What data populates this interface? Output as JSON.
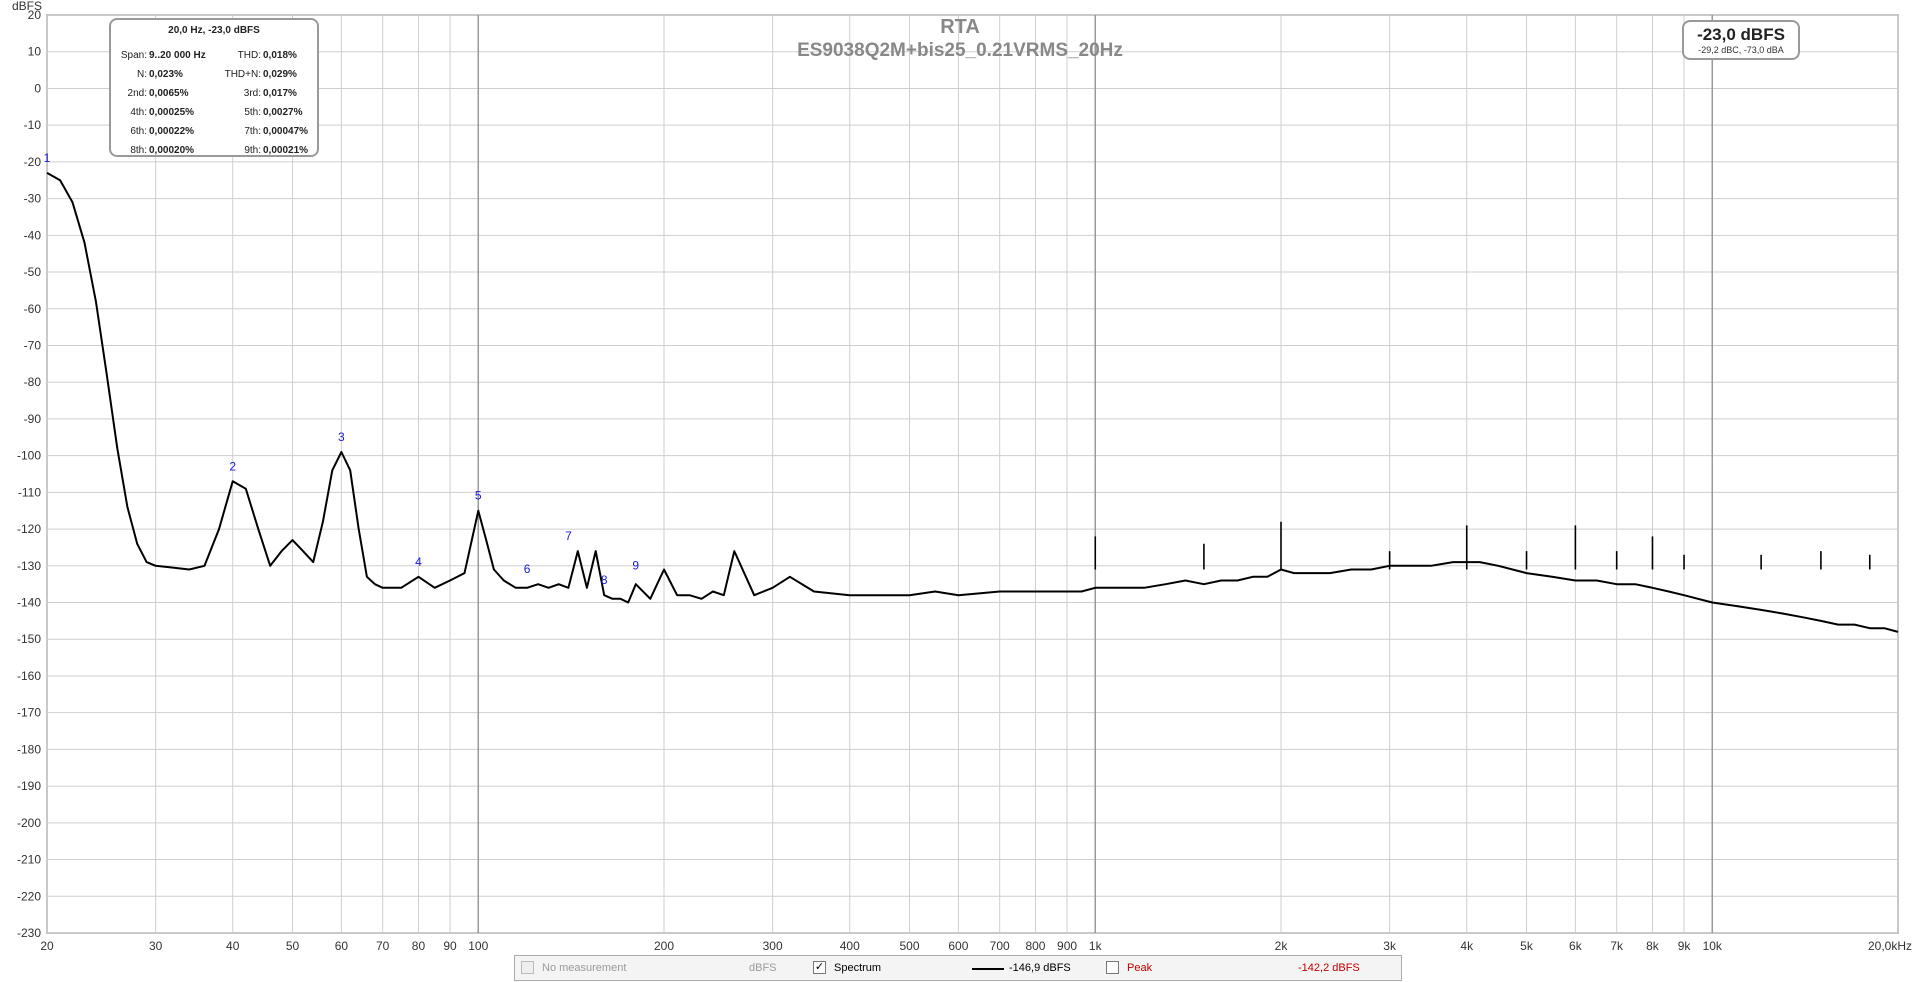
{
  "chart_data": {
    "type": "line",
    "title": "RTA",
    "subtitle": "ES9038Q2M+bis25_0.21VRMS_20Hz",
    "ylabel": "dBFS",
    "xscale": "log",
    "xlim": [
      20,
      20000
    ],
    "ylim": [
      -230,
      20
    ],
    "grid": true,
    "yticks": [
      20,
      10,
      0,
      -10,
      -20,
      -30,
      -40,
      -50,
      -60,
      -70,
      -80,
      -90,
      -100,
      -110,
      -120,
      -130,
      -140,
      -150,
      -160,
      -170,
      -180,
      -190,
      -200,
      -210,
      -220,
      -230
    ],
    "xticks": [
      {
        "f": 20,
        "label": "20"
      },
      {
        "f": 30,
        "label": "30"
      },
      {
        "f": 40,
        "label": "40"
      },
      {
        "f": 50,
        "label": "50"
      },
      {
        "f": 60,
        "label": "60"
      },
      {
        "f": 70,
        "label": "70"
      },
      {
        "f": 80,
        "label": "80"
      },
      {
        "f": 90,
        "label": "90"
      },
      {
        "f": 100,
        "label": "100"
      },
      {
        "f": 200,
        "label": "200"
      },
      {
        "f": 300,
        "label": "300"
      },
      {
        "f": 400,
        "label": "400"
      },
      {
        "f": 500,
        "label": "500"
      },
      {
        "f": 600,
        "label": "600"
      },
      {
        "f": 700,
        "label": "700"
      },
      {
        "f": 800,
        "label": "800"
      },
      {
        "f": 900,
        "label": "900"
      },
      {
        "f": 1000,
        "label": "1k"
      },
      {
        "f": 2000,
        "label": "2k"
      },
      {
        "f": 3000,
        "label": "3k"
      },
      {
        "f": 4000,
        "label": "4k"
      },
      {
        "f": 5000,
        "label": "5k"
      },
      {
        "f": 6000,
        "label": "6k"
      },
      {
        "f": 7000,
        "label": "7k"
      },
      {
        "f": 8000,
        "label": "8k"
      },
      {
        "f": 9000,
        "label": "9k"
      },
      {
        "f": 10000,
        "label": "10k"
      },
      {
        "f": 20000,
        "label": "20,0kHz"
      }
    ],
    "series": [
      {
        "name": "Spectrum",
        "x": [
          20,
          21,
          22,
          23,
          24,
          25,
          26,
          27,
          28,
          29,
          30,
          32,
          34,
          36,
          38,
          40,
          42,
          44,
          46,
          48,
          50,
          52,
          54,
          56,
          58,
          60,
          62,
          64,
          66,
          68,
          70,
          75,
          80,
          85,
          90,
          95,
          100,
          103,
          106,
          110,
          115,
          120,
          125,
          130,
          135,
          140,
          145,
          150,
          155,
          160,
          165,
          170,
          175,
          180,
          190,
          200,
          210,
          220,
          230,
          240,
          250,
          260,
          280,
          300,
          320,
          350,
          400,
          450,
          500,
          550,
          600,
          700,
          800,
          900,
          950,
          1000,
          1100,
          1200,
          1300,
          1400,
          1500,
          1600,
          1700,
          1800,
          1900,
          2000,
          2100,
          2200,
          2400,
          2600,
          2800,
          3000,
          3200,
          3500,
          3800,
          4000,
          4200,
          4500,
          5000,
          5500,
          6000,
          6500,
          7000,
          7500,
          8000,
          8500,
          9000,
          10000,
          11000,
          12000,
          13000,
          14000,
          15000,
          16000,
          17000,
          18000,
          19000,
          20000
        ],
        "y": [
          -23,
          -25,
          -31,
          -42,
          -58,
          -78,
          -98,
          -114,
          -124,
          -129,
          -130,
          -130.5,
          -131,
          -130,
          -120,
          -107,
          -109,
          -120,
          -130,
          -126,
          -123,
          -126,
          -129,
          -118,
          -104,
          -99,
          -104,
          -120,
          -133,
          -135,
          -136,
          -136,
          -133,
          -136,
          -134,
          -132,
          -115,
          -123,
          -131,
          -134,
          -136,
          -136,
          -135,
          -136,
          -135,
          -136,
          -126,
          -136,
          -126,
          -138,
          -139,
          -139,
          -140,
          -135,
          -139,
          -131,
          -138,
          -138,
          -139,
          -137,
          -138,
          -126,
          -138,
          -136,
          -133,
          -137,
          -138,
          -138,
          -138,
          -137,
          -138,
          -137,
          -137,
          -137,
          -137,
          -136,
          -136,
          -136,
          -135,
          -134,
          -135,
          -134,
          -134,
          -133,
          -133,
          -131,
          -132,
          -132,
          -132,
          -131,
          -131,
          -130,
          -130,
          -130,
          -129,
          -129,
          -129,
          -130,
          -132,
          -133,
          -134,
          -134,
          -135,
          -135,
          -136,
          -137,
          -138,
          -140,
          -141,
          -142,
          -143,
          -144,
          -145,
          -146,
          -146,
          -147,
          -147,
          -148
        ]
      }
    ],
    "peaks": [
      {
        "f": 2000,
        "y": -118
      },
      {
        "f": 3000,
        "y": -126
      },
      {
        "f": 4000,
        "y": -119
      },
      {
        "f": 6000,
        "y": -119
      },
      {
        "f": 8000,
        "y": -122
      },
      {
        "f": 1000,
        "y": -122
      },
      {
        "f": 1500,
        "y": -124
      },
      {
        "f": 5000,
        "y": -126
      },
      {
        "f": 7000,
        "y": -126
      },
      {
        "f": 9000,
        "y": -127
      },
      {
        "f": 12000,
        "y": -127
      },
      {
        "f": 15000,
        "y": -126
      },
      {
        "f": 18000,
        "y": -127
      }
    ],
    "markers": [
      {
        "label": "1",
        "f": 20,
        "y": -20
      },
      {
        "label": "2",
        "f": 40,
        "y": -104
      },
      {
        "label": "3",
        "f": 60,
        "y": -96
      },
      {
        "label": "4",
        "f": 80,
        "y": -130
      },
      {
        "label": "5",
        "f": 100,
        "y": -112
      },
      {
        "label": "6",
        "f": 120,
        "y": -132
      },
      {
        "label": "7",
        "f": 140,
        "y": -123
      },
      {
        "label": "8",
        "f": 160,
        "y": -135
      },
      {
        "label": "9",
        "f": 180,
        "y": -131
      }
    ]
  },
  "info_box": {
    "header": "20,0 Hz, -23,0 dBFS",
    "rows": [
      {
        "lk": "Span:",
        "lv": "9..20 000 Hz",
        "rk": "THD:",
        "rv": "0,018%"
      },
      {
        "lk": "N:",
        "lv": "0,023%",
        "rk": "THD+N:",
        "rv": "0,029%"
      },
      {
        "lk": "2nd:",
        "lv": "0,0065%",
        "rk": "3rd:",
        "rv": "0,017%"
      },
      {
        "lk": "4th:",
        "lv": "0,00025%",
        "rk": "5th:",
        "rv": "0,0027%"
      },
      {
        "lk": "6th:",
        "lv": "0,00022%",
        "rk": "7th:",
        "rv": "0,00047%"
      },
      {
        "lk": "8th:",
        "lv": "0,00020%",
        "rk": "9th:",
        "rv": "0,00021%"
      }
    ]
  },
  "level_box": {
    "main": "-23,0 dBFS",
    "sub": "-29,2 dBC, -73,0 dBA"
  },
  "legend": {
    "no_measurement": "No measurement",
    "no_measurement_value": "dBFS",
    "spectrum_label": "Spectrum",
    "spectrum_value": "-146,9 dBFS",
    "peak_label": "Peak",
    "peak_value": "-142,2 dBFS",
    "peak_color": "#c00000"
  }
}
